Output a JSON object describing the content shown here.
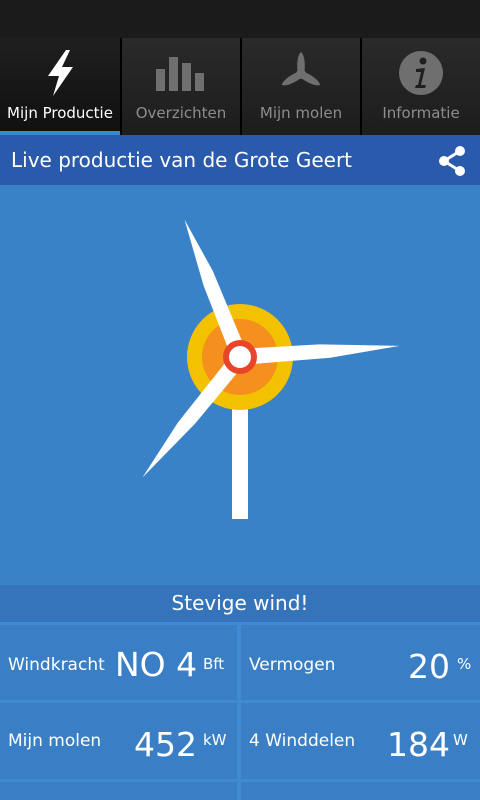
{
  "tabs": [
    {
      "label": "Mijn Productie",
      "icon": "lightning-icon",
      "active": true
    },
    {
      "label": "Overzichten",
      "icon": "bar-chart-icon",
      "active": false
    },
    {
      "label": "Mijn molen",
      "icon": "propeller-icon",
      "active": false
    },
    {
      "label": "Informatie",
      "icon": "info-icon",
      "active": false
    }
  ],
  "header": {
    "title": "Live productie van de Grote Geert",
    "share_icon": "share-icon"
  },
  "status": {
    "text": "Stevige wind!"
  },
  "stats": {
    "windkracht": {
      "label": "Windkracht",
      "value": "NO 4",
      "unit": "Bft"
    },
    "vermogen": {
      "label": "Vermogen",
      "value": "20",
      "unit": "%"
    },
    "mijn_molen": {
      "label": "Mijn molen",
      "value": "452",
      "unit": "kW"
    },
    "winddelen": {
      "label": "4 Winddelen",
      "value": "184",
      "unit": "W"
    }
  },
  "colors": {
    "background": "#3a82c8",
    "header": "#2a5aab",
    "hub_outer": "#f2c200",
    "hub_mid": "#f5901e",
    "hub_inner": "#e8462a"
  }
}
